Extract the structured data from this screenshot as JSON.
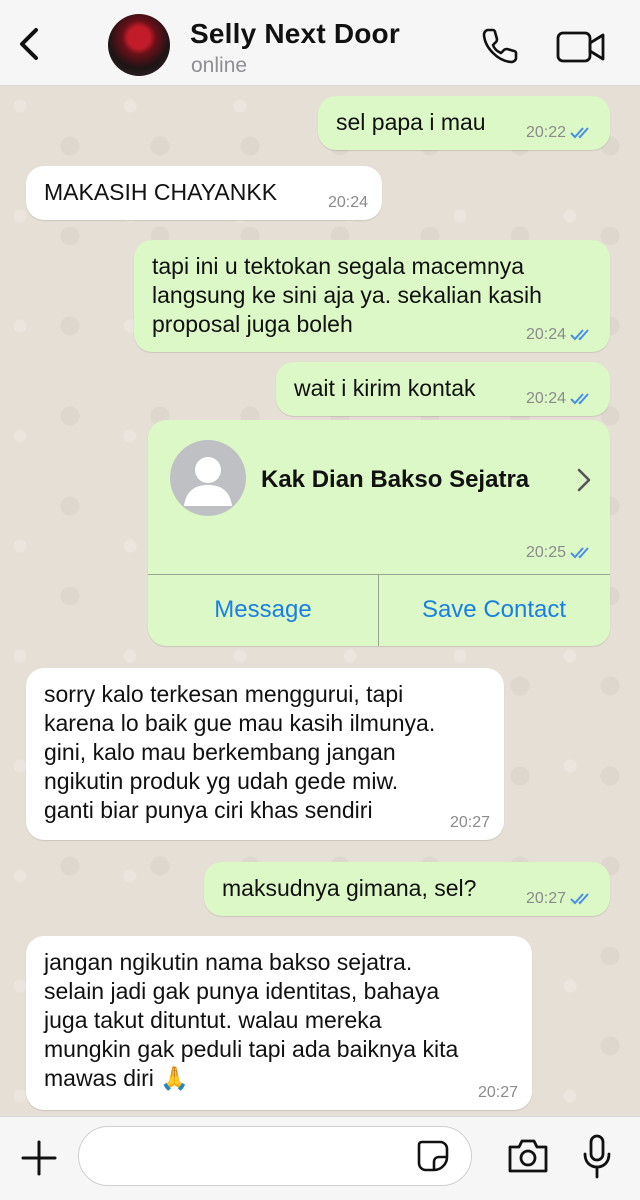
{
  "header": {
    "contact_name": "Selly Next Door",
    "status": "online"
  },
  "messages": [
    {
      "direction": "out",
      "text": "sel papa i mau",
      "time": "20:22",
      "read": true
    },
    {
      "direction": "in",
      "text": "MAKASIH CHAYANKK",
      "time": "20:24"
    },
    {
      "direction": "out",
      "text": "tapi ini u tektokan segala macemnya\nlangsung ke sini aja ya. sekalian kasih\nproposal juga boleh",
      "time": "20:24",
      "read": true
    },
    {
      "direction": "out",
      "text": "wait i kirim kontak",
      "time": "20:24",
      "read": true
    },
    {
      "direction": "in",
      "text": "sorry kalo terkesan menggurui, tapi\nkarena lo baik gue mau kasih ilmunya.\ngini, kalo mau berkembang jangan\nngikutin produk yg udah gede miw.\nganti biar punya ciri khas sendiri",
      "time": "20:27"
    },
    {
      "direction": "out",
      "text": "maksudnya gimana, sel?",
      "time": "20:27",
      "read": true
    },
    {
      "direction": "in",
      "text": "jangan ngikutin nama bakso sejatra.\nselain jadi gak punya identitas, bahaya\njuga takut dituntut. walau mereka\nmungkin gak peduli tapi ada baiknya kita\nmawas diri 🙏",
      "time": "20:27"
    }
  ],
  "contact_card": {
    "name": "Kak Dian Bakso Sejatra",
    "time": "20:25",
    "read": true,
    "message_label": "Message",
    "save_label": "Save Contact"
  },
  "input": {
    "placeholder": ""
  },
  "icons": {
    "back": "chevron-left-icon",
    "call": "phone-icon",
    "video": "video-camera-icon",
    "plus": "plus-icon",
    "sticker": "sticker-icon",
    "camera": "camera-icon",
    "mic": "microphone-icon",
    "ticks": "double-check-icon"
  },
  "colors": {
    "outgoing_bubble": "#dcf8c6",
    "incoming_bubble": "#ffffff",
    "read_ticks": "#4a90e2",
    "action_blue": "#1a7fe0"
  }
}
